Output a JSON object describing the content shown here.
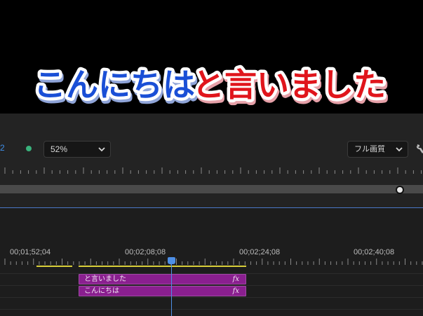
{
  "preview": {
    "caption_part1": "こんにちは",
    "caption_part2": "と言いました",
    "caption_color1": "#1a4fd6",
    "caption_color2": "#e0151c"
  },
  "controls": {
    "page_number": "2",
    "status_color": "#39b27c",
    "zoom_value": "52%",
    "quality_value": "フル画質",
    "settings_icon": "wrench-icon"
  },
  "timeline": {
    "timecodes": [
      "00;01;52;04",
      "00;02;08;08",
      "00;02;24;08",
      "00;02;40;08"
    ],
    "clips": [
      {
        "label": "と言いました",
        "fx": "fx"
      },
      {
        "label": "こんにちは",
        "fx": "fx"
      }
    ],
    "clip_color": "#8a1f8f",
    "playhead_color": "#4d8fe6"
  }
}
